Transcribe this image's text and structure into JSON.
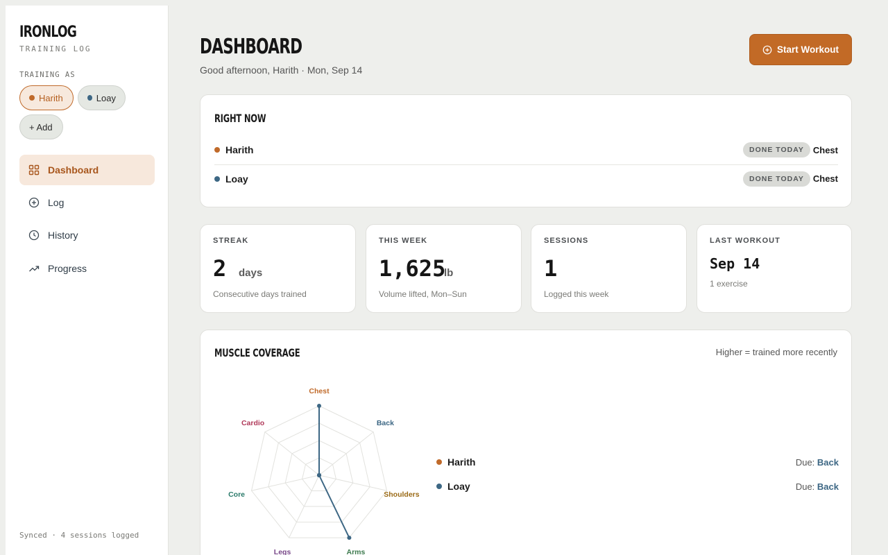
{
  "brand": {
    "name": "IRONLOG",
    "subtitle": "TRAINING LOG"
  },
  "sidebar": {
    "training_as_label": "TRAINING AS",
    "users": [
      {
        "name": "Harith",
        "color": "#c06a2a",
        "active": true
      },
      {
        "name": "Loay",
        "color": "#3d6784",
        "active": false
      }
    ],
    "add_label": "+ Add",
    "nav": [
      {
        "label": "Dashboard",
        "icon": "grid-icon",
        "active": true
      },
      {
        "label": "Log",
        "icon": "plus-circle-icon",
        "active": false
      },
      {
        "label": "History",
        "icon": "clock-icon",
        "active": false
      },
      {
        "label": "Progress",
        "icon": "trending-up-icon",
        "active": false
      }
    ],
    "sync_status": "Synced · 4 sessions logged"
  },
  "header": {
    "title": "DASHBOARD",
    "greeting": "Good afternoon, Harith · Mon, Sep 14",
    "start_button": "Start Workout"
  },
  "right_now": {
    "title": "RIGHT NOW",
    "rows": [
      {
        "name": "Harith",
        "color": "#c06a2a",
        "badge": "DONE TODAY",
        "muscle": "Chest"
      },
      {
        "name": "Loay",
        "color": "#3d6784",
        "badge": "DONE TODAY",
        "muscle": "Chest"
      }
    ]
  },
  "stats": [
    {
      "label": "STREAK",
      "value": "2",
      "unit": "days",
      "sub": "Consecutive days trained"
    },
    {
      "label": "THIS WEEK",
      "value": "1,625",
      "unit": "lb",
      "sub": "Volume lifted, Mon–Sun"
    },
    {
      "label": "SESSIONS",
      "value": "1",
      "unit": "",
      "sub": "Logged this week"
    },
    {
      "label": "LAST WORKOUT",
      "value": "Sep 14",
      "unit": "",
      "sub": "1 exercise"
    }
  ],
  "coverage": {
    "title": "MUSCLE COVERAGE",
    "hint": "Higher = trained more recently",
    "axes": [
      {
        "label": "Chest",
        "color": "#c06a2a"
      },
      {
        "label": "Back",
        "color": "#3d6784"
      },
      {
        "label": "Shoulders",
        "color": "#9a6a16"
      },
      {
        "label": "Arms",
        "color": "#3d7a4e"
      },
      {
        "label": "Legs",
        "color": "#7a4a8a"
      },
      {
        "label": "Core",
        "color": "#2a7a6a"
      },
      {
        "label": "Cardio",
        "color": "#b03a5a"
      }
    ],
    "series": [
      {
        "name": "Harith",
        "color": "#c06a2a",
        "due_label": "Due:",
        "due": "Back"
      },
      {
        "name": "Loay",
        "color": "#3d6784",
        "due_label": "Due:",
        "due": "Back"
      }
    ]
  },
  "chart_data": {
    "type": "radar",
    "categories": [
      "Chest",
      "Back",
      "Shoulders",
      "Arms",
      "Legs",
      "Core",
      "Cardio"
    ],
    "series": [
      {
        "name": "Loay",
        "values": [
          1,
          0,
          0,
          1,
          0,
          0,
          0
        ]
      }
    ],
    "ylim": [
      0,
      1
    ]
  }
}
